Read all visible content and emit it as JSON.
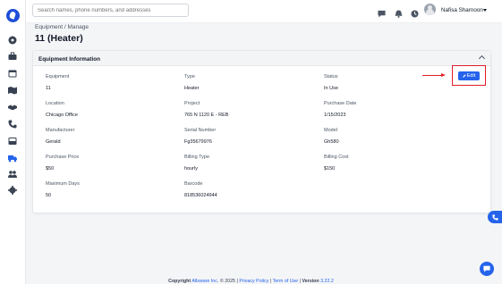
{
  "search": {
    "placeholder": "Search names, phone numbers, and addresses"
  },
  "user": {
    "name": "Nafisa Sharnoon"
  },
  "breadcrumb": "Equipment / Manage",
  "page_title": "11 (Heater)",
  "card": {
    "title": "Equipment Information",
    "edit_label": "Edit",
    "fields": [
      {
        "label": "Equipment",
        "value": "11"
      },
      {
        "label": "Type",
        "value": "Heater"
      },
      {
        "label": "Status",
        "value": "In Use"
      },
      {
        "label": "Location",
        "value": "Chicago Office"
      },
      {
        "label": "Project",
        "value": "765 N 1120 E - REB"
      },
      {
        "label": "Purchase Date",
        "value": "1/15/2023"
      },
      {
        "label": "Manufacturer",
        "value": "Gerald"
      },
      {
        "label": "Serial Number",
        "value": "Fg35679976"
      },
      {
        "label": "Model",
        "value": "Gh580"
      },
      {
        "label": "Purchase Price",
        "value": "$50"
      },
      {
        "label": "Billing Type",
        "value": "hourly"
      },
      {
        "label": "Billing Cost",
        "value": "$150"
      },
      {
        "label": "Maximum Days",
        "value": "50"
      },
      {
        "label": "Barcode",
        "value": "818536024944"
      }
    ]
  },
  "footer": {
    "copyright": "Copyright",
    "company": "Allsware Inc.",
    "year_text": "© 2025 |",
    "privacy": "Privacy Policy",
    "sep": "|",
    "terms": "Term of Use",
    "version_label": "Version",
    "version": "3.22.2"
  },
  "colors": {
    "accent": "#2563eb",
    "highlight": "#e11d26"
  },
  "icons": {
    "sidebar": [
      "logo",
      "dashboard-icon",
      "briefcase-icon",
      "calendar-icon",
      "map-icon",
      "handshake-icon",
      "phone-icon",
      "inbox-icon",
      "truck-icon",
      "people-icon",
      "gear-icon"
    ],
    "topbar": [
      "chat-icon",
      "bell-icon",
      "clock-icon"
    ]
  }
}
